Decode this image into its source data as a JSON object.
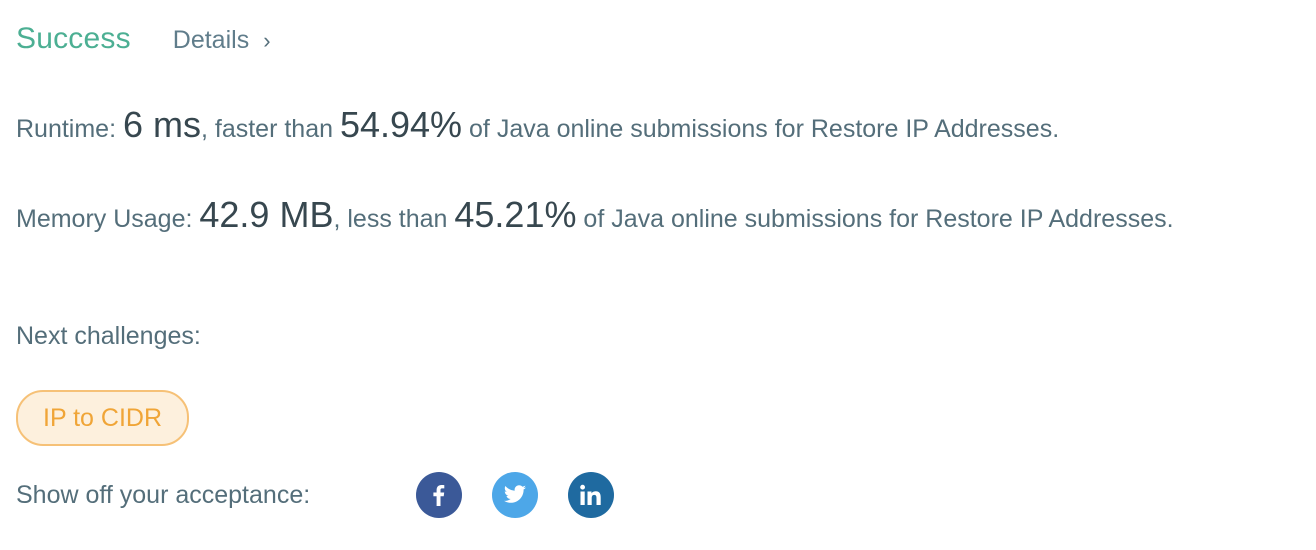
{
  "header": {
    "status": "Success",
    "details_label": "Details"
  },
  "runtime": {
    "label": "Runtime: ",
    "value": "6 ms",
    "comparison": ", faster than ",
    "percent": "54.94%",
    "suffix": " of Java online submissions for Restore IP Addresses."
  },
  "memory": {
    "label": "Memory Usage: ",
    "value": "42.9 MB",
    "comparison": ", less than ",
    "percent": "45.21%",
    "suffix": " of Java online submissions for Restore IP Addresses."
  },
  "next": {
    "label": "Next challenges:",
    "challenges": [
      {
        "label": "IP to CIDR"
      }
    ]
  },
  "share": {
    "label": "Show off your acceptance:",
    "buttons": [
      {
        "icon": "facebook-icon",
        "color": "#3b5998"
      },
      {
        "icon": "twitter-icon",
        "color": "#4da7e8"
      },
      {
        "icon": "linkedin-icon",
        "color": "#1f6aa0"
      }
    ]
  },
  "colors": {
    "success": "#4caf93",
    "challenge_border": "#f6c177",
    "challenge_bg": "#fdf0dd",
    "challenge_text": "#f0a537"
  }
}
